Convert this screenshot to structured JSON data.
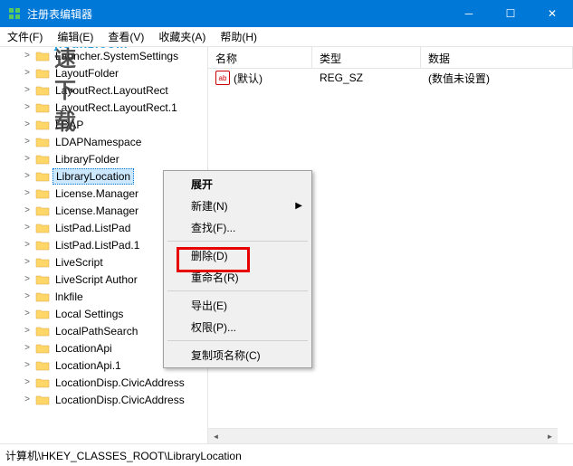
{
  "window": {
    "title": "注册表编辑器"
  },
  "menu": {
    "file": "文件(F)",
    "edit": "编辑(E)",
    "view": "查看(V)",
    "favorites": "收藏夹(A)",
    "help": "帮助(H)"
  },
  "watermark": {
    "text": "极速下载",
    "sub": "jisuxz.com"
  },
  "tree": [
    "Launcher.SystemSettings",
    "LayoutFolder",
    "LayoutRect.LayoutRect",
    "LayoutRect.LayoutRect.1",
    "LDAP",
    "LDAPNamespace",
    "LibraryFolder",
    "LibraryLocation",
    "License.Manager",
    "License.Manager",
    "ListPad.ListPad",
    "ListPad.ListPad.1",
    "LiveScript",
    "LiveScript Author",
    "lnkfile",
    "Local Settings",
    "LocalPathSearch",
    "LocationApi",
    "LocationApi.1",
    "LocationDisp.CivicAddress",
    "LocationDisp.CivicAddress"
  ],
  "tree_selected_index": 7,
  "columns": {
    "name": "名称",
    "type": "类型",
    "data": "数据"
  },
  "rows": [
    {
      "icon": "ab",
      "name": "(默认)",
      "type": "REG_SZ",
      "data": "(数值未设置)"
    }
  ],
  "context": {
    "expand": "展开",
    "new": "新建(N)",
    "find": "查找(F)...",
    "delete": "删除(D)",
    "rename": "重命名(R)",
    "export": "导出(E)",
    "permissions": "权限(P)...",
    "copykey": "复制项名称(C)"
  },
  "statusbar": "计算机\\HKEY_CLASSES_ROOT\\LibraryLocation"
}
